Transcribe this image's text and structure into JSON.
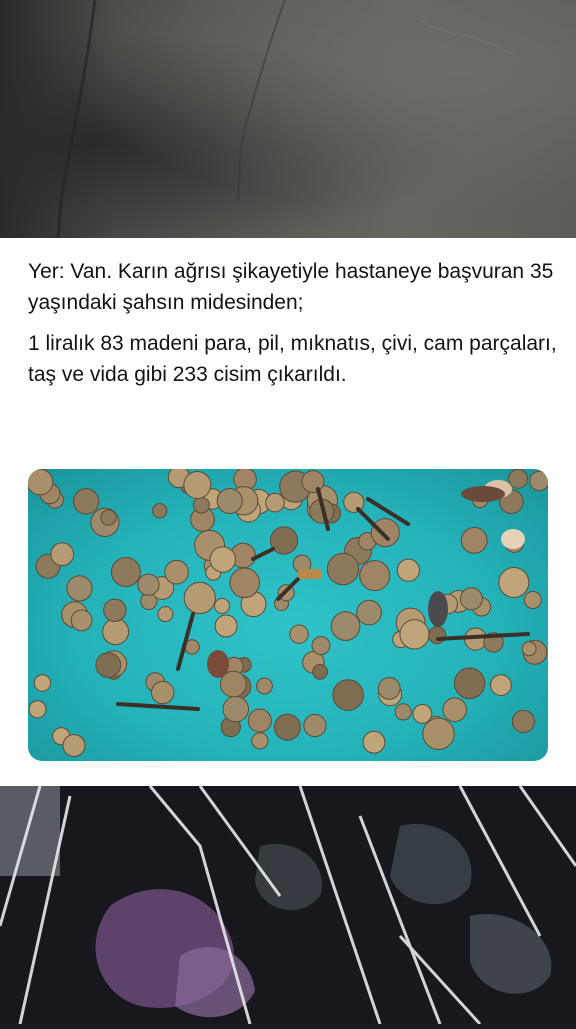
{
  "tweet": {
    "paragraph_1": "Yer: Van. Karın ağrısı şikayetiyle hastaneye başvuran 35 yaşındaki şahsın midesinden;",
    "paragraph_2": "1 liralık 83 madeni para, pil, mıknatıs, çivi, cam parçaları, taş ve vida gibi 233 cisim çıkarıldı."
  },
  "colors": {
    "media_background": "#2bbdc3",
    "card_background": "#ffffff",
    "text": "#0f1419"
  }
}
